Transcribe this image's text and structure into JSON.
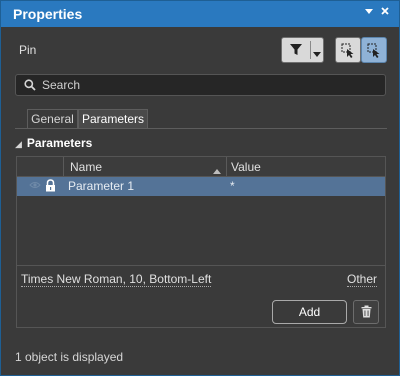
{
  "window": {
    "title": "Properties",
    "menu_icon": "menu-triangle-icon",
    "close_icon": "close-icon"
  },
  "object_type": "Pin",
  "search": {
    "placeholder": "Search"
  },
  "tabs": [
    {
      "label": "General",
      "active": false
    },
    {
      "label": "Parameters",
      "active": true
    }
  ],
  "section": {
    "title": "Parameters",
    "expanded": true
  },
  "grid": {
    "columns": [
      "Name",
      "Value"
    ],
    "rows": [
      {
        "name": "Parameter 1",
        "value": "*",
        "visible": false,
        "locked": true,
        "selected": true
      }
    ]
  },
  "font_info": "Times New Roman, 10, Bottom-Left",
  "other_link": "Other",
  "add_button": "Add",
  "status": "1 object is displayed",
  "colors": {
    "titlebar": "#2a79bf",
    "selected_row": "#547397",
    "panel_bg": "#3a3a3a"
  }
}
